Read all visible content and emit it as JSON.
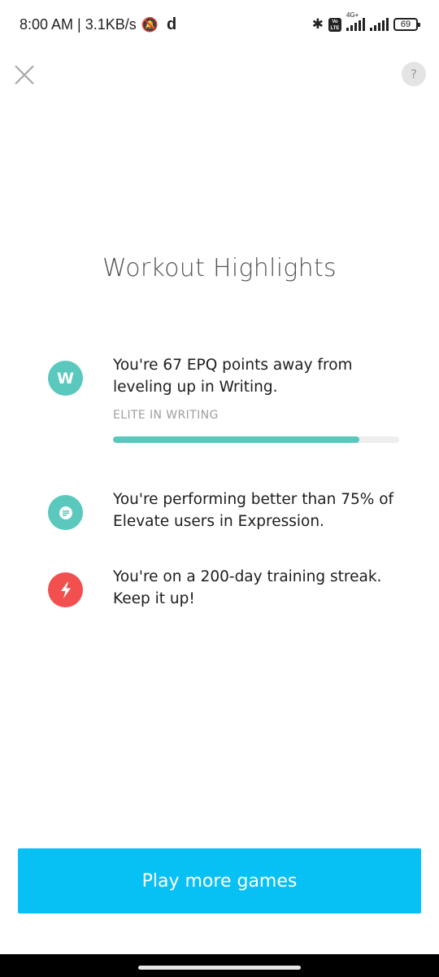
{
  "status_bar": {
    "time_speed": "8:00 AM | 3.1KB/s",
    "network_label": "4G+",
    "battery_level": "69"
  },
  "screen": {
    "title": "Workout Highlights"
  },
  "highlights": [
    {
      "icon": "writing-w-badge",
      "icon_letter": "W",
      "icon_color": "#5ac8bd",
      "text": "You're 67 EPQ points away from leveling up in Writing.",
      "progress_label": "ELITE IN WRITING",
      "progress_fraction": 0.86
    },
    {
      "icon": "speech-bubble-icon",
      "icon_color": "#5ac8bd",
      "text": "You're performing better than 75% of Elevate users in Expression."
    },
    {
      "icon": "lightning-bolt-icon",
      "icon_color": "#f1504f",
      "text": "You're on a 200-day training streak. Keep it up!"
    }
  ],
  "cta": {
    "label": "Play more games",
    "color": "#08c1f4"
  },
  "controls": {
    "close_icon": "close-icon",
    "help_label": "?"
  }
}
